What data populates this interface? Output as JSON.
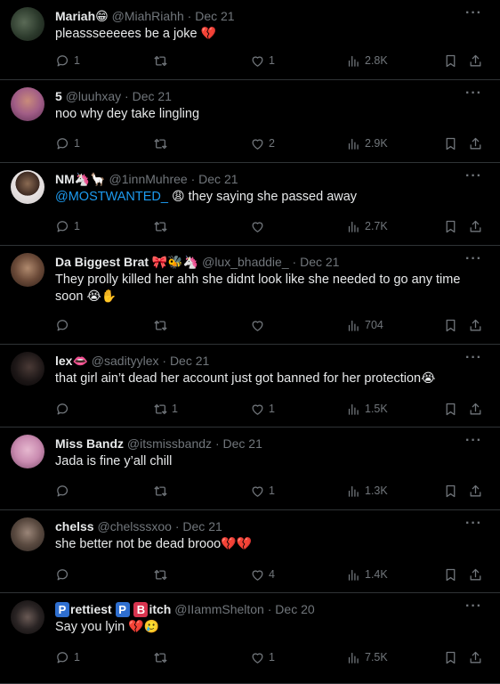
{
  "tweets": [
    {
      "name": "Mariah",
      "name_emoji": "😁",
      "handle": "@MiahRiahh",
      "date": "Dec 21",
      "text": "pleassseeeees be a joke",
      "text_emoji": "💔",
      "replies": "1",
      "retweets": "",
      "likes": "1",
      "views": "2.8K"
    },
    {
      "name": "5",
      "name_emoji": "",
      "handle": "@luuhxay",
      "date": "Dec 21",
      "text": "noo why dey take lingling",
      "text_emoji": "",
      "replies": "1",
      "retweets": "",
      "likes": "2",
      "views": "2.9K"
    },
    {
      "name": "NM",
      "name_emoji": "🦄🦙",
      "handle": "@1innMuhree",
      "date": "Dec 21",
      "mention": "@MOSTWANTED_",
      "text": " they saying she passed  away",
      "text_emoji_pre": "😩",
      "replies": "1",
      "retweets": "",
      "likes": "",
      "views": "2.7K"
    },
    {
      "name": "Da Biggest Brat",
      "name_emoji": "🎀🐝🦄",
      "handle": "@lux_bhaddie_",
      "date": "Dec 21",
      "text": "They prolly killed her ahh she didnt look like she needed to go any time soon",
      "text_emoji": "😭✋",
      "replies": "",
      "retweets": "",
      "likes": "",
      "views": "704"
    },
    {
      "name": "lex",
      "name_emoji": "👄",
      "handle": "@sadityylex",
      "date": "Dec 21",
      "text": "that girl ain’t dead her account just got banned for her protection",
      "text_emoji": "😭",
      "replies": "",
      "retweets": "1",
      "likes": "1",
      "views": "1.5K"
    },
    {
      "name": "Miss Bandz",
      "name_emoji": "",
      "handle": "@itsmissbandz",
      "date": "Dec 21",
      "text": "Jada is fine y’all chill",
      "text_emoji": "",
      "replies": "",
      "retweets": "",
      "likes": "1",
      "views": "1.3K"
    },
    {
      "name": "chelss",
      "name_emoji": "",
      "handle": "@chelsssxoo",
      "date": "Dec 21",
      "text": "she better not be dead brooo",
      "text_emoji": "💔💔",
      "replies": "",
      "retweets": "",
      "likes": "4",
      "views": "1.4K"
    },
    {
      "name_badges": [
        "P",
        "P",
        "B"
      ],
      "name_parts": [
        "rettiest ",
        "itch"
      ],
      "handle": "@IIammShelton",
      "date": "Dec 20",
      "text": "Say you lyin",
      "text_emoji": "💔🥲",
      "replies": "1",
      "retweets": "",
      "likes": "1",
      "views": "7.5K"
    }
  ],
  "colors": {
    "background": "#000000",
    "primary_text": "#e7e9ea",
    "secondary_text": "#71767b",
    "divider": "#2f3336",
    "mention": "#1d9bf0"
  },
  "icons": [
    "reply-icon",
    "retweet-icon",
    "like-icon",
    "views-icon",
    "bookmark-icon",
    "share-icon",
    "more-icon"
  ]
}
